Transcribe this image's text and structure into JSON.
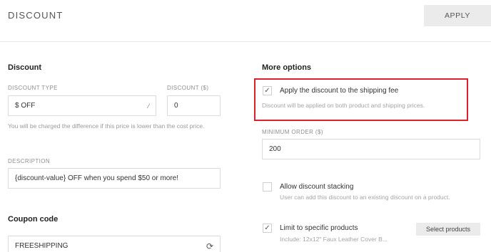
{
  "header": {
    "title": "DISCOUNT",
    "apply_label": "APPLY"
  },
  "discount": {
    "section_title": "Discount",
    "type_label": "DISCOUNT TYPE",
    "type_value": "$ OFF",
    "amount_label": "DISCOUNT ($)",
    "amount_value": "0",
    "hint": "You will be charged the difference if this price is lower than the cost price.",
    "description_label": "DESCRIPTION",
    "description_value": "{discount-value} OFF when you spend $50 or more!"
  },
  "coupon": {
    "section_title": "Coupon code",
    "code_value": "FREESHIPPING",
    "refresh_icon": "refresh-icon"
  },
  "more_options": {
    "section_title": "More options",
    "shipping": {
      "checked": true,
      "label": "Apply the discount to the shipping fee",
      "description": "Discount will be applied on both product and shipping prices."
    },
    "min_order_label": "MINIMUM ORDER ($)",
    "min_order_value": "200",
    "stacking": {
      "checked": false,
      "label": "Allow discount stacking",
      "description": "User can add this discount to an existing discount on a product."
    },
    "limit": {
      "checked": true,
      "label": "Limit to specific products",
      "description": "Include: 12x12\" Faux Leather Cover B...",
      "select_label": "Select products"
    }
  },
  "colors": {
    "highlight": "#d9202d",
    "button_bg": "#ebebeb"
  }
}
